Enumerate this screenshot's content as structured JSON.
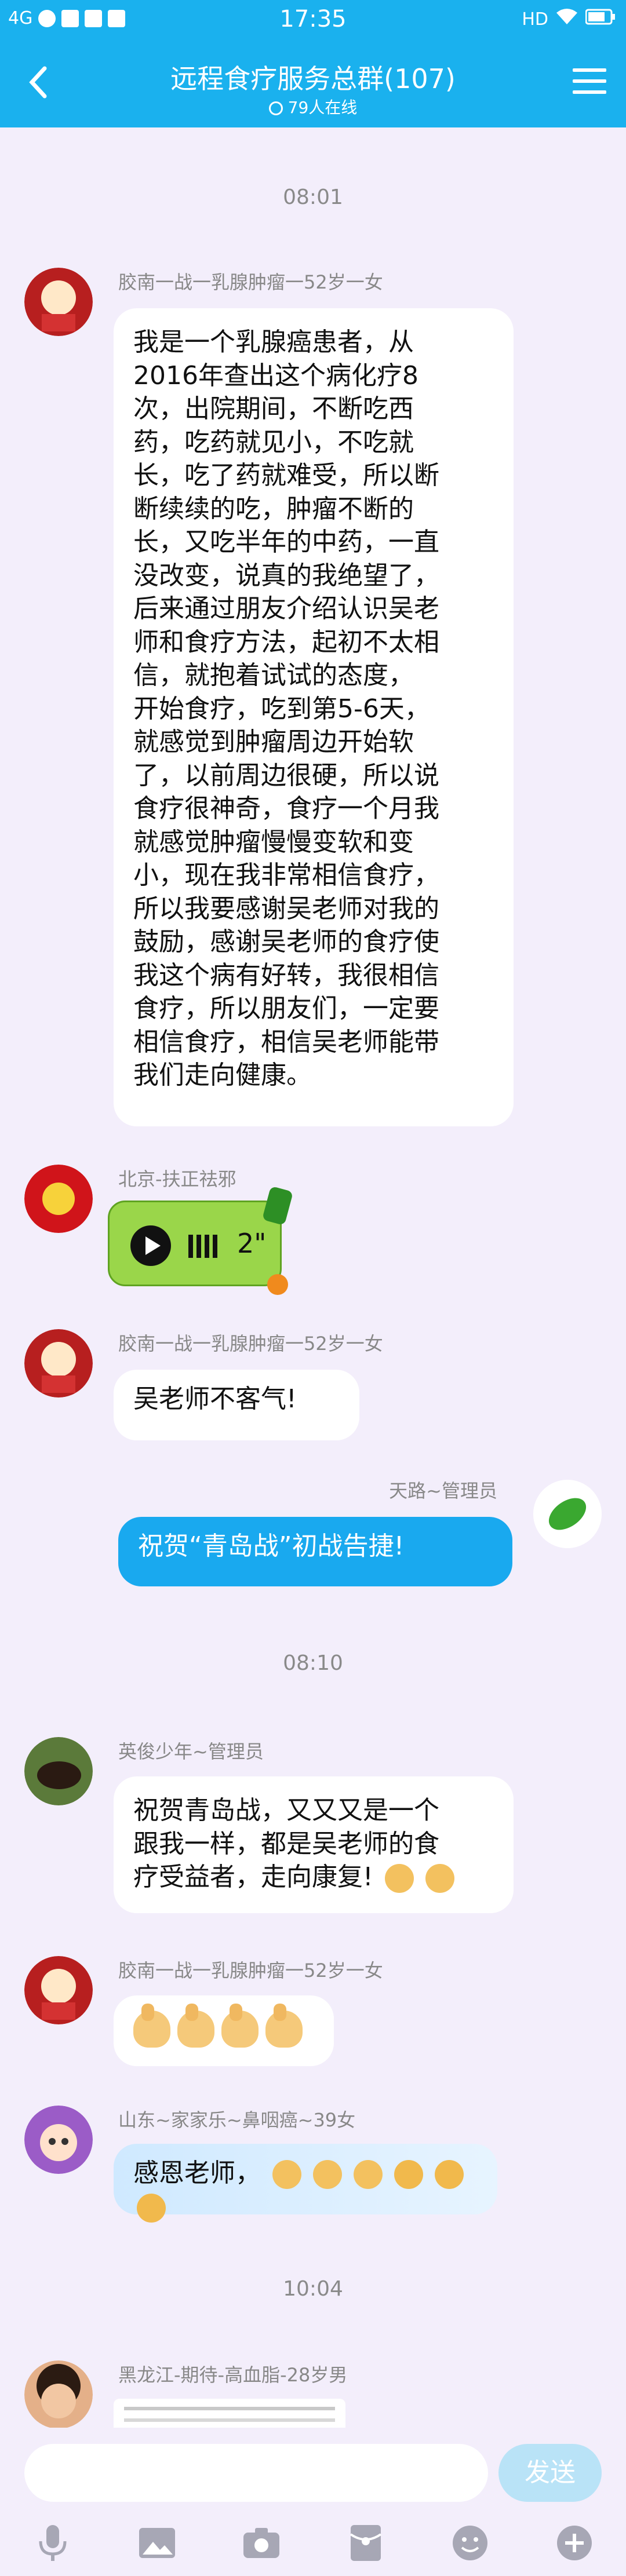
{
  "status_bar": {
    "network": "4G",
    "time": "17:35",
    "hd": "HD"
  },
  "header": {
    "title": "远程食疗服务总群(107)",
    "online": "79人在线"
  },
  "messages": {
    "ts1": "08:01",
    "m1_sender": "胶南一战一乳腺肿瘤一52岁一女",
    "m1_lines": [
      "我是一个乳腺癌患者，从",
      "2016年查出这个病化疗8",
      "次，出院期间，不断吃西",
      "药，吃药就见小，不吃就",
      "长，吃了药就难受，所以断",
      "断续续的吃，肿瘤不断的",
      "长，又吃半年的中药，一直",
      "没改变，说真的我绝望了，",
      "后来通过朋友介绍认识吴老",
      "师和食疗方法，起初不太相",
      "信，就抱着试试的态度，",
      "开始食疗，吃到第5-6天，",
      "就感觉到肿瘤周边开始软",
      "了，以前周边很硬，所以说",
      "食疗很神奇，食疗一个月我",
      "就感觉肿瘤慢慢变软和变",
      "小，现在我非常相信食疗，",
      "所以我要感谢吴老师对我的",
      "鼓励，感谢吴老师的食疗使",
      "我这个病有好转，我很相信",
      "食疗，所以朋友们，一定要",
      "相信食疗，相信吴老师能带",
      "我们走向健康。"
    ],
    "m2_sender": "北京-扶正祛邪",
    "m2_voice_duration": "2\"",
    "m3_sender": "胶南一战一乳腺肿瘤一52岁一女",
    "m3_text": "吴老师不客气!",
    "m4_sender": "天路~管理员",
    "m4_text": "祝贺“青岛战”初战告捷!",
    "ts2": "08:10",
    "m5_sender": "英俊少年~管理员",
    "m5_line1": "祝贺青岛战，又又又是一个",
    "m5_line2": "跟我一样，都是吴老师的食",
    "m5_line3": "疗受益者，走向康复!",
    "m6_sender": "胶南一战一乳腺肿瘤一52岁一女",
    "m7_sender": "山东~家家乐~鼻咽癌~39女",
    "m7_text": "感恩老师，",
    "ts3": "10:04",
    "m8_sender": "黑龙江-期待-高血脂-28岁男"
  },
  "input_bar": {
    "send_label": "发送"
  },
  "toolbar": [
    "mic-icon",
    "image-icon",
    "camera-icon",
    "red-packet-icon",
    "emoji-icon",
    "plus-icon"
  ],
  "colors": {
    "header": "#1ab1ee",
    "background": "#f3eefb",
    "own_bubble": "#19a9ef"
  }
}
